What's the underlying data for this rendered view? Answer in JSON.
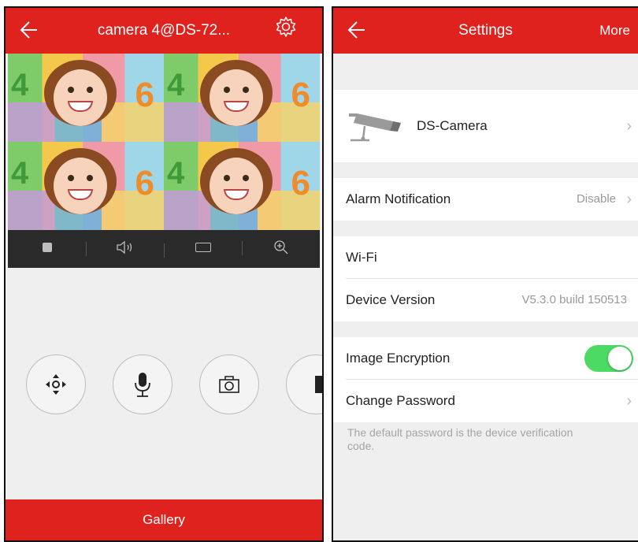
{
  "caption": {
    "pre": "",
    "highlight": "",
    "post": ""
  },
  "live_view": {
    "title": "camera 4@DS-72...",
    "gallery_label": "Gallery"
  },
  "settings": {
    "title": "Settings",
    "more_label": "More",
    "device_name": "DS-Camera",
    "alarm_label": "Alarm Notification",
    "alarm_value": "Disable",
    "wifi_label": "Wi-Fi",
    "version_label": "Device Version",
    "version_value": "V5.3.0 build 150513",
    "encryption_label": "Image Encryption",
    "encryption_on": true,
    "password_label": "Change Password",
    "password_note": "The default password is the device verification code."
  },
  "colors": {
    "brand_red": "#e0221f",
    "toggle_green": "#4cd964"
  },
  "icons": [
    "back-arrow-icon",
    "gear-icon",
    "stop-icon",
    "speaker-icon",
    "window-icon",
    "zoom-in-icon",
    "ptz-icon",
    "microphone-icon",
    "camera-icon",
    "camera-device-icon",
    "chevron-right-icon"
  ]
}
